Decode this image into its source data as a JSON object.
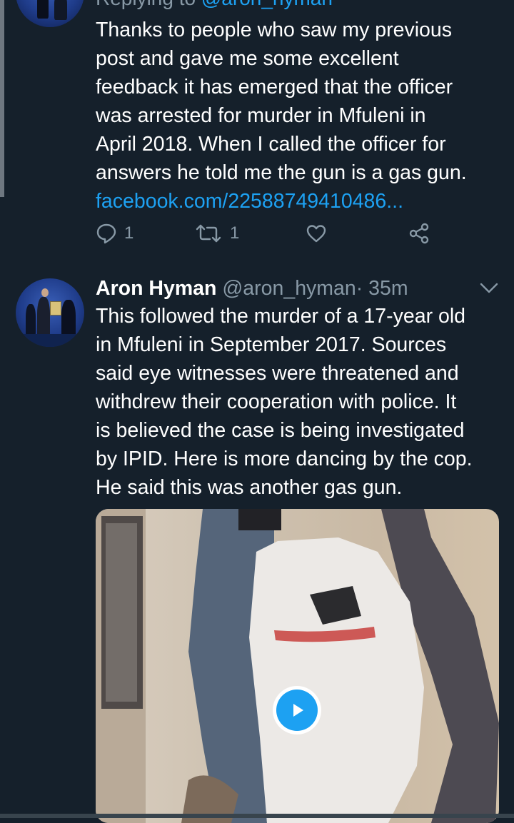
{
  "reply_context": {
    "prefix": "Replying to",
    "handle": "@aron_hyman"
  },
  "tweet1": {
    "lines": [
      "Thanks to people who saw my previous",
      "post and gave me some excellent",
      "feedback it has emerged that the officer",
      "was arrested for murder in Mfuleni in",
      "April 2018. When I called the officer for",
      "answers he told me the gun is a gas gun."
    ],
    "link": "facebook.com/22588749410486...",
    "reply_count": "1",
    "retweet_count": "1"
  },
  "tweet2": {
    "author_name": "Aron Hyman",
    "author_handle": "@aron_hyman",
    "separator": "·",
    "time": "35m",
    "lines": [
      "This followed the murder of a 17-year old",
      "in Mfuleni in September 2017. Sources",
      "said eye witnesses were threatened and",
      "withdrew their cooperation with police. It",
      "is believed the case is being investigated",
      "by IPID. Here is more dancing by the cop.",
      "He said this was another gas gun."
    ]
  },
  "icons": {
    "reply": "reply-icon",
    "retweet": "retweet-icon",
    "like": "heart-icon",
    "share": "share-icon",
    "menu": "chevron-down-icon",
    "play": "play-icon"
  },
  "colors": {
    "background": "#15202b",
    "link": "#1da1f2",
    "muted": "#8899a6",
    "text": "#ffffff"
  }
}
